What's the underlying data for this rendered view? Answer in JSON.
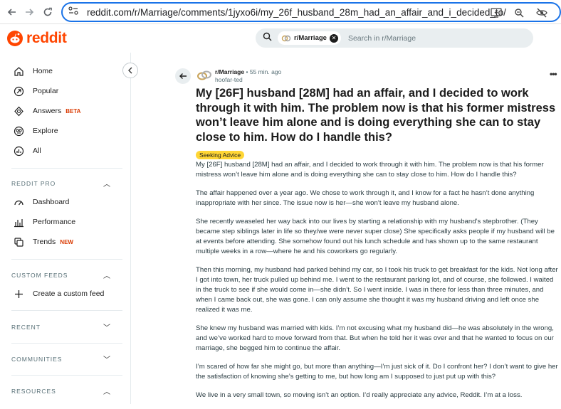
{
  "browser": {
    "url_domain": "reddit.com",
    "url_path": "/r/Marriage/comments/1jyxo6i/my_26f_husband_28m_had_an_affair_and_i_decided_to/"
  },
  "header": {
    "logo_text": "reddit",
    "search_chip": "r/Marriage",
    "search_placeholder": "Search in r/Marriage"
  },
  "sidebar": {
    "nav": [
      {
        "label": "Home",
        "icon": "home-icon"
      },
      {
        "label": "Popular",
        "icon": "popular-icon"
      },
      {
        "label": "Answers",
        "badge": "BETA",
        "icon": "answers-icon"
      },
      {
        "label": "Explore",
        "icon": "explore-icon"
      },
      {
        "label": "All",
        "icon": "all-icon"
      }
    ],
    "reddit_pro": {
      "title": "REDDIT PRO",
      "items": [
        {
          "label": "Dashboard",
          "icon": "dashboard-icon"
        },
        {
          "label": "Performance",
          "icon": "performance-icon"
        },
        {
          "label": "Trends",
          "badge": "NEW",
          "icon": "trends-icon"
        }
      ]
    },
    "custom_feeds": {
      "title": "CUSTOM FEEDS",
      "create": "Create a custom feed"
    },
    "recent": "RECENT",
    "communities": "COMMUNITIES",
    "resources": "RESOURCES"
  },
  "post": {
    "subreddit": "r/Marriage",
    "time": "55 min. ago",
    "author": "hoofar-ted",
    "title": "My [26F] husband [28M] had an affair, and I decided to work through it with him. The problem now is that his former mistress won’t leave him alone and is doing everything she can to stay close to him. How do I handle this?",
    "flair": "Seeking Advice",
    "paragraphs": [
      "My [26F] husband [28M] had an affair, and I decided to work through it with him. The problem now is that his former mistress won’t leave him alone and is doing everything she can to stay close to him. How do I handle this?",
      "The affair happened over a year ago. We chose to work through it, and I know for a fact he hasn’t done anything inappropriate with her since. The issue now is her—she won’t leave my husband alone.",
      "She recently weaseled her way back into our lives by starting a relationship with my husband’s stepbrother. (They became step siblings later in life so they/we were never super close) She specifically asks people if my husband will be at events before attending. She somehow found out his lunch schedule and has shown up to the same restaurant multiple weeks in a row—where he and his coworkers go regularly.",
      "Then this morning, my husband had parked behind my car, so I took his truck to get breakfast for the kids. Not long after I got into town, her truck pulled up behind me. I went to the restaurant parking lot, and of course, she followed. I waited in the truck to see if she would come in—she didn’t. So I went inside. I was in there for less than three minutes, and when I came back out, she was gone. I can only assume she thought it was my husband driving and left once she realized it was me.",
      "She knew my husband was married with kids. I’m not excusing what my husband did—he was absolutely in the wrong, and we’ve worked hard to move forward from that. But when he told her it was over and that he wanted to focus on our marriage, she begged him to continue the affair.",
      "I’m scared of how far she might go, but more than anything—I’m just sick of it. Do I confront her? I don’t want to give her the satisfaction of knowing she’s getting to me, but how long am I supposed to just put up with this?",
      "We live in a very small town, so moving isn’t an option. I’d really appreciate any advice, Reddit. I’m at a loss."
    ]
  }
}
